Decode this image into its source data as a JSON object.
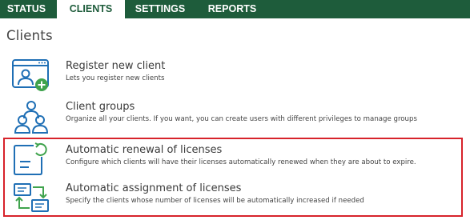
{
  "tabs": [
    {
      "label": "STATUS",
      "active": false
    },
    {
      "label": "CLIENTS",
      "active": true
    },
    {
      "label": "SETTINGS",
      "active": false
    },
    {
      "label": "REPORTS",
      "active": false
    }
  ],
  "page": {
    "title": "Clients"
  },
  "items": [
    {
      "label": "Register new client",
      "description": "Lets you register new clients",
      "icon": "register-client-icon"
    },
    {
      "label": "Client groups",
      "description": "Organize all your clients. If you want, you can create users with different privileges to manage groups",
      "icon": "client-groups-icon"
    },
    {
      "label": "Automatic renewal of licenses",
      "description": "Configure which clients will have their licenses automatically renewed when they are about to expire.",
      "icon": "license-renewal-icon"
    },
    {
      "label": "Automatic assignment of licenses",
      "description": "Specify the clients whose number of licenses will be automatically increased if needed",
      "icon": "license-assignment-icon"
    }
  ],
  "colors": {
    "topbar": "#1e5c3b",
    "icon_blue": "#1f6fb5",
    "accent_green": "#3fa34d",
    "highlight_border": "#d7232b"
  }
}
